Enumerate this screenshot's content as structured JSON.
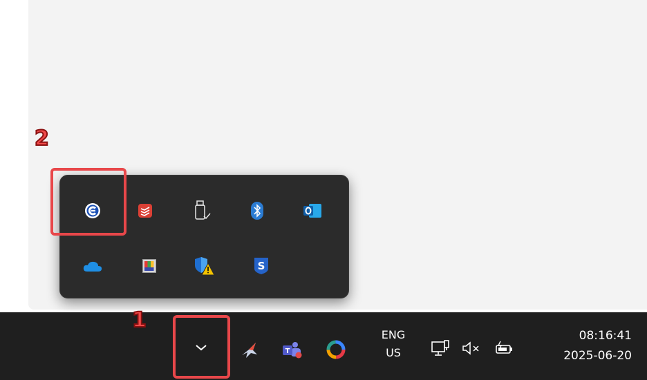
{
  "annotations": {
    "step1": "1",
    "step2": "2"
  },
  "tray_flyout": {
    "row1": [
      "ccleaner-icon",
      "todoist-icon",
      "usb-safely-remove-icon",
      "bluetooth-icon",
      "outlook-icon"
    ],
    "row2": [
      "onedrive-icon",
      "color-picker-icon",
      "defender-warning-icon",
      "security-app-icon"
    ]
  },
  "taskbar": {
    "overflow_chevron": "chevron-up-icon",
    "pinned_tray": [
      "plane-app-icon",
      "teams-icon",
      "sync-app-icon"
    ],
    "language": {
      "line1": "ENG",
      "line2": "US"
    },
    "system_icons": [
      "network-icon",
      "volume-muted-icon",
      "battery-charging-icon"
    ],
    "clock": {
      "time": "08:16:41",
      "date": "2025-06-20"
    }
  },
  "colors": {
    "taskbar_bg": "#1f1f1f",
    "flyout_bg": "#2b2b2b",
    "highlight": "#e8474a",
    "accent_blue": "#2b7cd3"
  }
}
